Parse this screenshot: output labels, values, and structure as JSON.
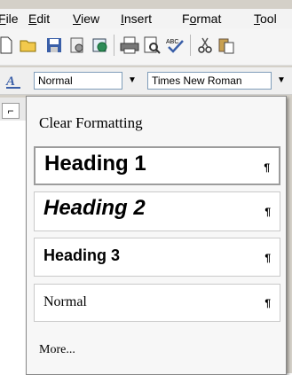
{
  "menubar": {
    "items": [
      {
        "pre": "",
        "ul": "F",
        "post": "ile"
      },
      {
        "pre": "",
        "ul": "E",
        "post": "dit"
      },
      {
        "pre": "",
        "ul": "V",
        "post": "iew"
      },
      {
        "pre": "",
        "ul": "I",
        "post": "nsert"
      },
      {
        "pre": "F",
        "ul": "o",
        "post": "rmat"
      },
      {
        "pre": "",
        "ul": "T",
        "post": "ool"
      }
    ]
  },
  "toolbar": {
    "icons": [
      "new-icon",
      "open-icon",
      "save-icon",
      "permissions-icon",
      "research-icon",
      "print-icon",
      "print-preview-icon",
      "spelling-icon",
      "cut-icon",
      "paste-icon"
    ]
  },
  "formatting": {
    "style_value": "Normal",
    "font_value": "Times New Roman"
  },
  "styles_dropdown": {
    "clear_label": "Clear Formatting",
    "items": [
      {
        "label": "Heading 1",
        "mark": "¶"
      },
      {
        "label": "Heading 2",
        "mark": "¶"
      },
      {
        "label": "Heading 3",
        "mark": "¶"
      },
      {
        "label": "Normal",
        "mark": "¶"
      }
    ],
    "more_label": "More..."
  }
}
